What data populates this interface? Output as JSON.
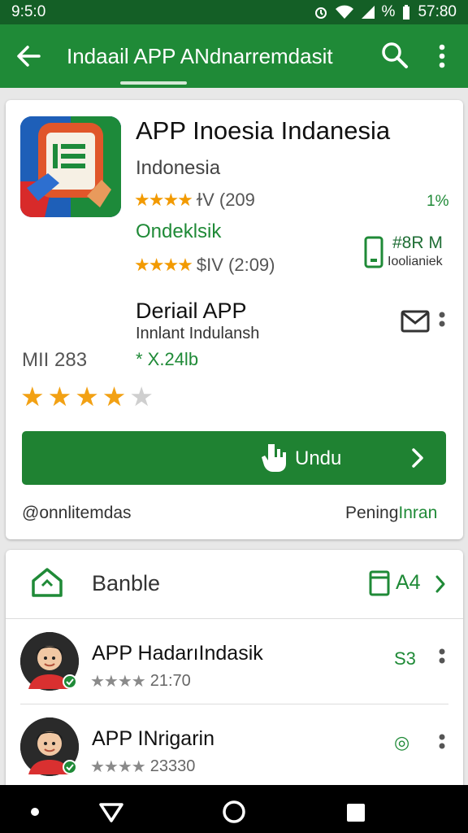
{
  "status": {
    "time": "9:5:0",
    "battery": "%",
    "clock": "57:80"
  },
  "appbar": {
    "title": "Indaail APP ANdnarremdasit"
  },
  "app": {
    "title": "APP Inoesia Indanesia",
    "subtitle": "Indonesia",
    "rating_text": "ɫV (209",
    "percent": "1%",
    "developer": "Ondeklsik",
    "rating_text2": "$IV (2:09)",
    "size_value": "#8R M",
    "size_label": "Ioolianiek"
  },
  "detail": {
    "title": "Deriail APP",
    "subtitle": "Innlant Indulansh",
    "rating_num": "MII 283",
    "rating_green": "* X.24lb",
    "stars_filled": 4,
    "stars_total": 5
  },
  "install": {
    "label": "Undu"
  },
  "footer": {
    "left": "@onnlitemdas",
    "right_prefix": "Pening",
    "right_link": "Inran"
  },
  "section": {
    "title": "Banble",
    "count": "A4"
  },
  "rows": [
    {
      "title": "APP HadarıIndasik",
      "meta": "21:70",
      "right": "S3"
    },
    {
      "title": "APP INrigarin",
      "meta": "23330",
      "right": "◎"
    }
  ],
  "colors": {
    "primary": "#1f8a37",
    "dark": "#145f26",
    "star": "#f2a114"
  }
}
